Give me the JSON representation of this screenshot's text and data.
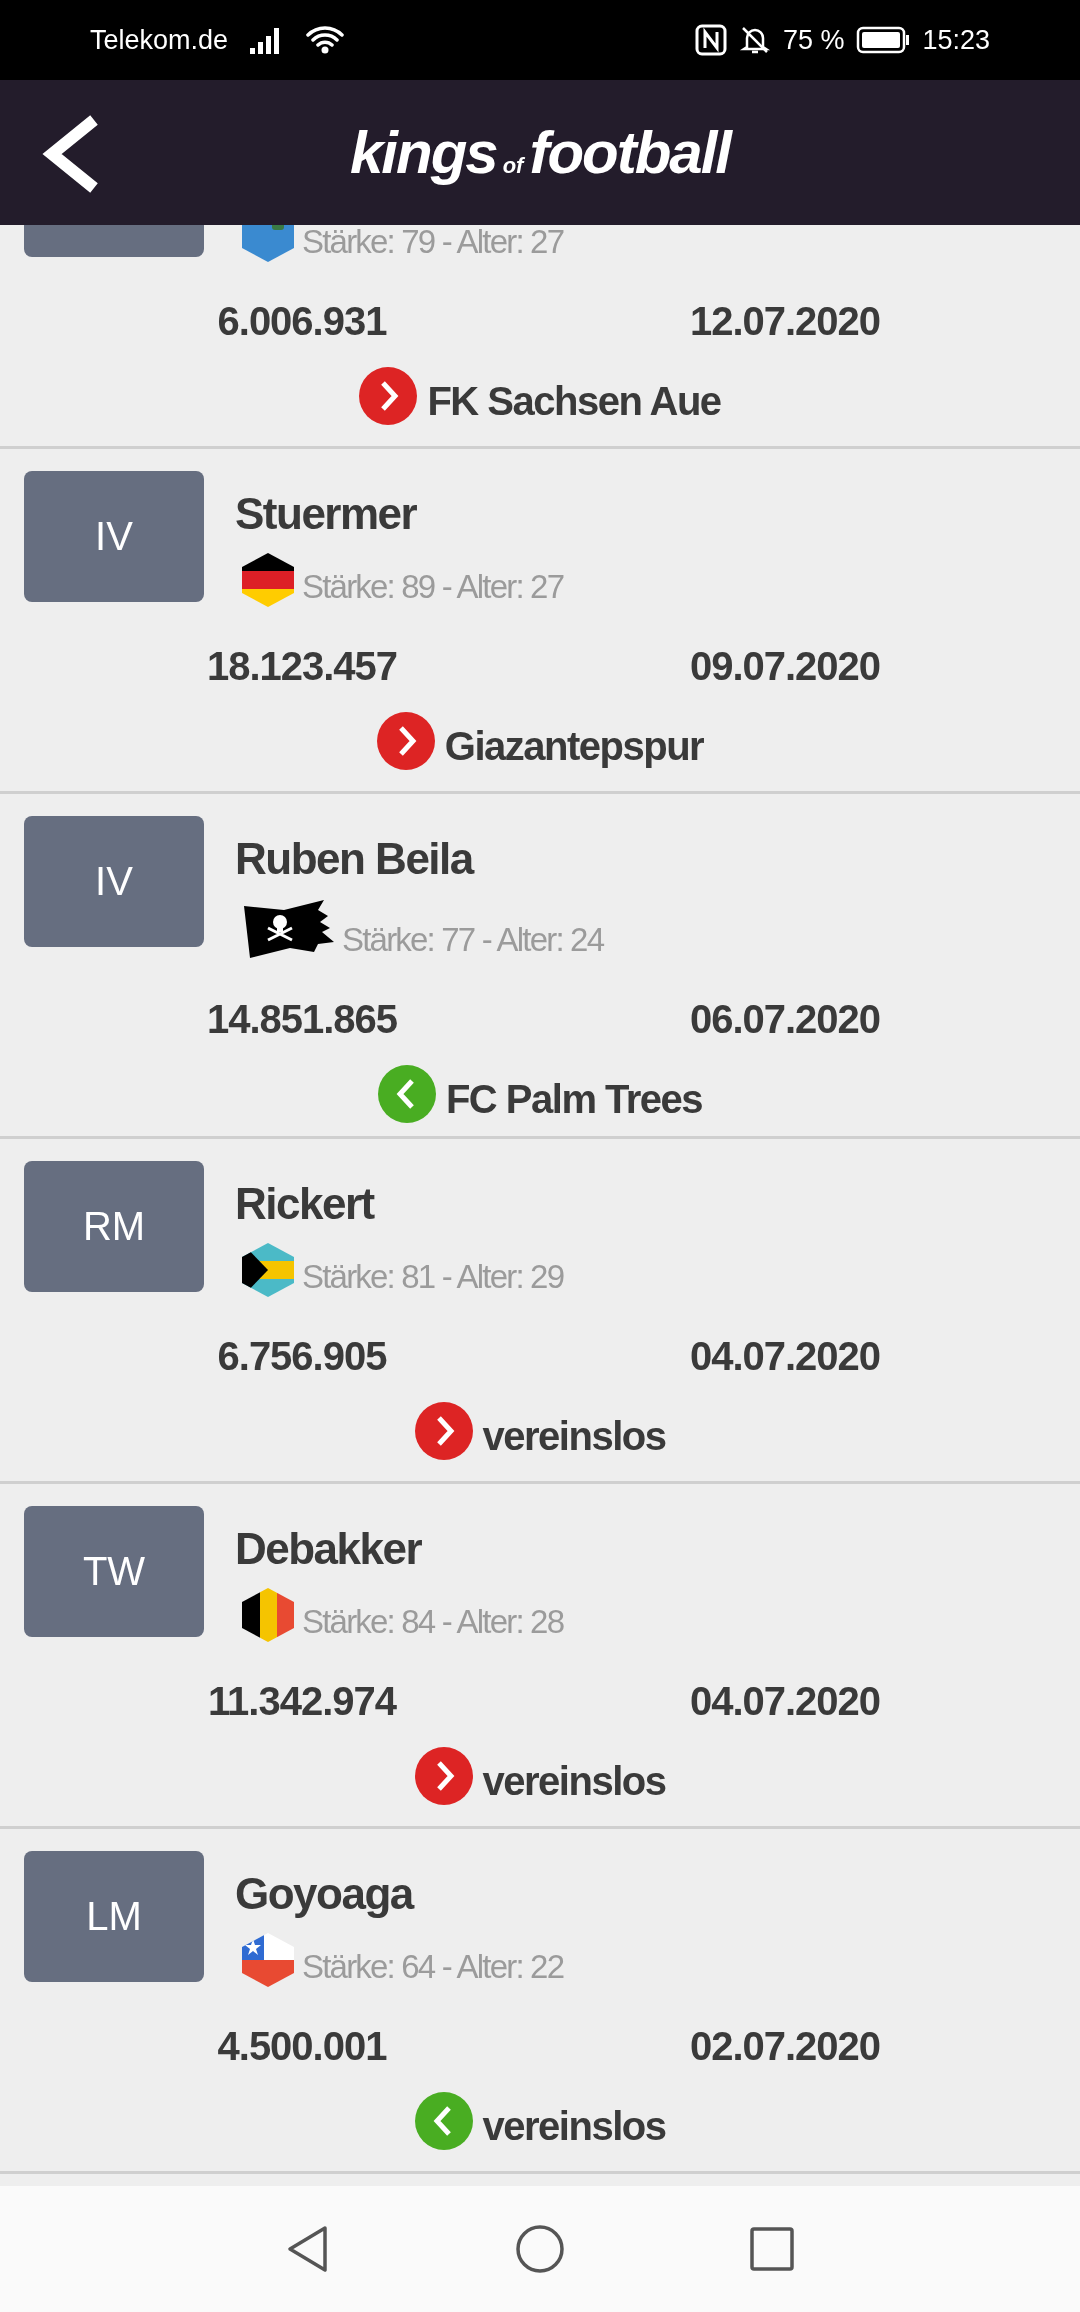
{
  "status_bar": {
    "carrier": "Telekom.de",
    "battery": "75 %",
    "time": "15:23"
  },
  "header": {
    "logo": [
      "kings",
      "of",
      "football"
    ]
  },
  "transfers": [
    {
      "flag": {
        "kind": "montserrat"
      },
      "stats": "Stärke: 79 - Alter: 27",
      "value": "6.006.931",
      "date": "12.07.2020",
      "incoming": false,
      "club": "FK Sachsen Aue"
    },
    {
      "position": "IV",
      "name": "Stuermer",
      "flag": {
        "kind": "germany"
      },
      "stats": "Stärke: 89 - Alter: 27",
      "value": "18.123.457",
      "date": "09.07.2020",
      "incoming": false,
      "club": "Giazantepspur"
    },
    {
      "position": "IV",
      "name": "Ruben Beila",
      "flag": {
        "kind": "pirate"
      },
      "stats": "Stärke: 77 - Alter: 24",
      "value": "14.851.865",
      "date": "06.07.2020",
      "incoming": true,
      "club": "FC Palm Trees"
    },
    {
      "position": "RM",
      "name": "Rickert",
      "flag": {
        "kind": "bahamas"
      },
      "stats": "Stärke: 81 - Alter: 29",
      "value": "6.756.905",
      "date": "04.07.2020",
      "incoming": false,
      "club": "vereinslos"
    },
    {
      "position": "TW",
      "name": "Debakker",
      "flag": {
        "kind": "belgium"
      },
      "stats": "Stärke: 84 - Alter: 28",
      "value": "11.342.974",
      "date": "04.07.2020",
      "incoming": false,
      "club": "vereinslos"
    },
    {
      "position": "LM",
      "name": "Goyoaga",
      "flag": {
        "kind": "chile"
      },
      "stats": "Stärke: 64 - Alter: 22",
      "value": "4.500.001",
      "date": "02.07.2020",
      "incoming": true,
      "club": "vereinslos"
    }
  ]
}
